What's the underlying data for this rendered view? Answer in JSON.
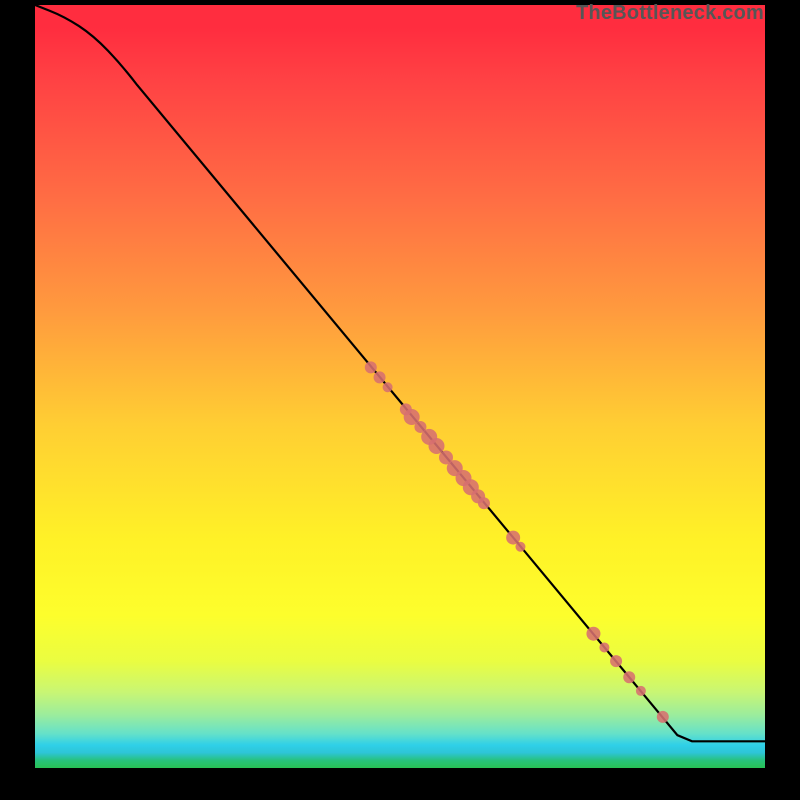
{
  "attribution": "TheBottleneck.com",
  "chart_data": {
    "type": "line",
    "title": "",
    "xlabel": "",
    "ylabel": "",
    "xlim": [
      0,
      100
    ],
    "ylim": [
      0,
      100
    ],
    "curve": [
      {
        "x": 0,
        "y": 100
      },
      {
        "x": 4,
        "y": 98.5
      },
      {
        "x": 8,
        "y": 96
      },
      {
        "x": 12,
        "y": 92
      },
      {
        "x": 16,
        "y": 87
      },
      {
        "x": 88,
        "y": 4.3
      },
      {
        "x": 90,
        "y": 3.5
      },
      {
        "x": 100,
        "y": 3.5
      }
    ],
    "markers": [
      {
        "x": 46.0,
        "y": 52.5,
        "r": 6
      },
      {
        "x": 47.2,
        "y": 51.2,
        "r": 6
      },
      {
        "x": 48.3,
        "y": 49.9,
        "r": 5
      },
      {
        "x": 50.8,
        "y": 47.0,
        "r": 6
      },
      {
        "x": 51.6,
        "y": 46.0,
        "r": 8
      },
      {
        "x": 52.8,
        "y": 44.7,
        "r": 6
      },
      {
        "x": 54.0,
        "y": 43.4,
        "r": 8
      },
      {
        "x": 55.0,
        "y": 42.2,
        "r": 8
      },
      {
        "x": 56.3,
        "y": 40.7,
        "r": 7
      },
      {
        "x": 57.5,
        "y": 39.3,
        "r": 8
      },
      {
        "x": 58.7,
        "y": 38.0,
        "r": 8
      },
      {
        "x": 59.7,
        "y": 36.8,
        "r": 8
      },
      {
        "x": 60.7,
        "y": 35.6,
        "r": 7
      },
      {
        "x": 61.5,
        "y": 34.7,
        "r": 6
      },
      {
        "x": 65.5,
        "y": 30.2,
        "r": 7
      },
      {
        "x": 66.5,
        "y": 29.0,
        "r": 5
      },
      {
        "x": 76.5,
        "y": 17.6,
        "r": 7
      },
      {
        "x": 78.0,
        "y": 15.8,
        "r": 5
      },
      {
        "x": 79.6,
        "y": 14.0,
        "r": 6
      },
      {
        "x": 81.4,
        "y": 11.9,
        "r": 6
      },
      {
        "x": 83.0,
        "y": 10.1,
        "r": 5
      },
      {
        "x": 86.0,
        "y": 6.7,
        "r": 6
      }
    ],
    "background_gradient_stops": [
      {
        "pos": 0.0,
        "color": "#ff2d3f"
      },
      {
        "pos": 0.25,
        "color": "#ff6c44"
      },
      {
        "pos": 0.55,
        "color": "#ffce33"
      },
      {
        "pos": 0.8,
        "color": "#fdfe2c"
      },
      {
        "pos": 0.95,
        "color": "#65e1c9"
      },
      {
        "pos": 1.0,
        "color": "#28c155"
      }
    ]
  }
}
